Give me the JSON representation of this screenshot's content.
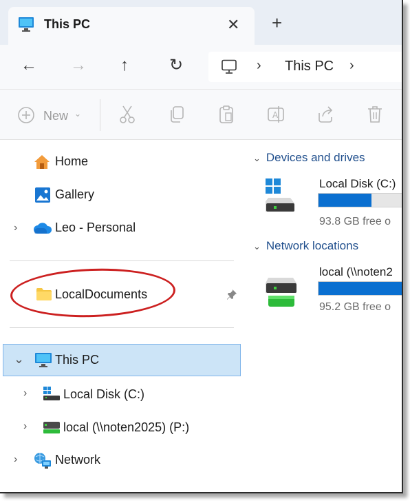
{
  "window": {
    "tab_title": "This PC",
    "close_glyph": "✕",
    "new_tab_glyph": "+"
  },
  "navigation": {
    "back_glyph": "←",
    "forward_glyph": "→",
    "up_glyph": "↑",
    "refresh_glyph": "↻",
    "address_icon": "computer-icon",
    "address_chevron": "›",
    "address_text": "This PC"
  },
  "command_bar": {
    "new_label": "New",
    "new_caret": "⌄",
    "icons": [
      "cut-icon",
      "copy-icon",
      "paste-icon",
      "rename-icon",
      "share-icon",
      "delete-icon"
    ]
  },
  "nav_pane": {
    "home_label": "Home",
    "gallery_label": "Gallery",
    "personal_label": "Leo - Personal",
    "pinned_folder_label": "LocalDocuments",
    "this_pc_label": "This PC",
    "local_disk_label": "Local Disk (C:)",
    "network_drive_label": "local (\\\\noten2025) (P:)",
    "network_label": "Network",
    "chevron_right": "›",
    "chevron_down": "⌄"
  },
  "content": {
    "devices_header": "Devices and drives",
    "network_header": "Network locations",
    "caret": "⌄",
    "drives": [
      {
        "name": "Local Disk (C:)",
        "free_text": "93.8 GB free o",
        "used_fraction": 0.6
      },
      {
        "name": "local (\\\\noten2",
        "free_text": "95.2 GB free o",
        "used_fraction": 1.0
      }
    ]
  },
  "colors": {
    "accent": "#0a6fd0",
    "selection": "#cce4f7",
    "annotation": "#cc2020",
    "header_text": "#1f4e8c"
  }
}
